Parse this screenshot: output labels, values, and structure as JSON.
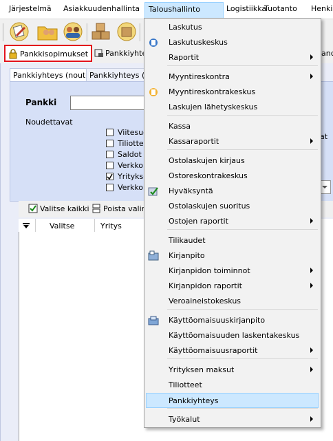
{
  "menubar": {
    "items": [
      "Järjestelmä",
      "Asiakkuudenhallinta",
      "Taloushallinto",
      "Logistiikka",
      "Tuotanto",
      "Henki"
    ]
  },
  "tabs": {
    "pankkisopimukset": "Pankkisopimukset",
    "pankkiyhteys": "Pankkiyhte",
    "right_clip": "anc"
  },
  "subtabs": {
    "nouto": "Pankkiyhteys (nouto)",
    "lahetys": "Pankkiyhteys (Lä"
  },
  "form": {
    "pankki_label": "Pankki",
    "noudettavat_label": "Noudettavat",
    "right_clip_label": "at",
    "checkboxes": [
      {
        "label": "Viitesuo",
        "checked": false
      },
      {
        "label": "Tiliottee",
        "checked": false
      },
      {
        "label": "Saldot",
        "checked": false
      },
      {
        "label": "Verkkola",
        "checked": false
      },
      {
        "label": "Yrityksen",
        "checked": true
      },
      {
        "label": "Verkkola",
        "checked": false
      }
    ]
  },
  "gridtoolbar": {
    "select_all": "Valitse kaikki",
    "deselect": "Poista valin"
  },
  "grid": {
    "columns": [
      "Valitse",
      "Yritys"
    ]
  },
  "menu": {
    "items": [
      {
        "label": "Laskutus",
        "icon": "",
        "submenu": false
      },
      {
        "label": "Laskutuskeskus",
        "icon": "invoice-center-icon",
        "submenu": false
      },
      {
        "label": "Raportit",
        "icon": "",
        "submenu": true
      },
      {
        "sep": true
      },
      {
        "label": "Myyntireskontra",
        "icon": "",
        "submenu": true
      },
      {
        "label": "Myyntireskontrakeskus",
        "icon": "sales-ledger-icon",
        "submenu": false
      },
      {
        "label": "Laskujen lähetyskeskus",
        "icon": "",
        "submenu": false
      },
      {
        "sep": true
      },
      {
        "label": "Kassa",
        "icon": "",
        "submenu": false
      },
      {
        "label": "Kassaraportit",
        "icon": "",
        "submenu": true
      },
      {
        "sep": true
      },
      {
        "label": "Ostolaskujen kirjaus",
        "icon": "",
        "submenu": false
      },
      {
        "label": "Ostoreskontrakeskus",
        "icon": "",
        "submenu": false
      },
      {
        "label": "Hyväksyntä",
        "icon": "approval-check-icon",
        "submenu": false
      },
      {
        "label": "Ostolaskujen suoritus",
        "icon": "",
        "submenu": false
      },
      {
        "label": "Ostojen raportit",
        "icon": "",
        "submenu": true
      },
      {
        "sep": true
      },
      {
        "label": "Tilikaudet",
        "icon": "",
        "submenu": false
      },
      {
        "label": "Kirjanpito",
        "icon": "bookkeeping-icon",
        "submenu": false
      },
      {
        "label": "Kirjanpidon toiminnot",
        "icon": "",
        "submenu": true
      },
      {
        "label": "Kirjanpidon raportit",
        "icon": "",
        "submenu": true
      },
      {
        "label": "Veroaineistokeskus",
        "icon": "",
        "submenu": false
      },
      {
        "sep": true
      },
      {
        "label": "Käyttöomaisuuskirjanpito",
        "icon": "fixed-assets-icon",
        "submenu": false
      },
      {
        "label": "Käyttöomaisuuden laskentakeskus",
        "icon": "",
        "submenu": false
      },
      {
        "label": "Käyttöomaisuusraportit",
        "icon": "",
        "submenu": true
      },
      {
        "sep": true
      },
      {
        "label": "Yrityksen maksut",
        "icon": "",
        "submenu": true
      },
      {
        "label": "Tiliotteet",
        "icon": "",
        "submenu": false
      },
      {
        "label": "Pankkiyhteys",
        "icon": "",
        "submenu": false,
        "highlighted": true
      },
      {
        "sep": true
      },
      {
        "label": "Työkalut",
        "icon": "",
        "submenu": true
      }
    ]
  },
  "colors": {
    "menu_highlight": "#cce8ff",
    "tab_outline": "#e3121b",
    "form_bg": "#d6e0f7"
  }
}
